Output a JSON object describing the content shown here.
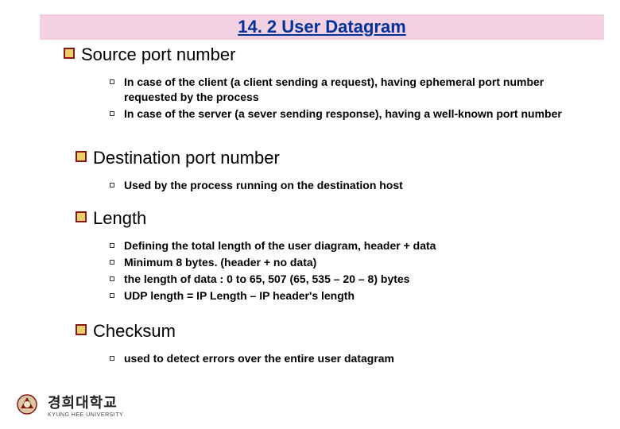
{
  "title": "14. 2 User Datagram",
  "sections": {
    "source": {
      "heading": "Source port number",
      "items": [
        "In case of the client (a client sending a request), having ephemeral port number requested by the process",
        "In case of the server (a sever sending response), having a well-known port number"
      ]
    },
    "dest": {
      "heading": "Destination port number",
      "items": [
        "Used by the process running on the destination host"
      ]
    },
    "length": {
      "heading": "Length",
      "items": [
        "Defining the total length of the user diagram, header + data",
        "Minimum 8 bytes. (header + no data)",
        "the length of data : 0 to 65, 507 (65, 535 – 20 – 8) bytes",
        "UDP length = IP Length – IP header's length"
      ]
    },
    "checksum": {
      "heading": "Checksum",
      "items": [
        "used to detect errors over the entire user datagram"
      ]
    }
  },
  "logo": {
    "korean": "경희대학교",
    "english": "KYUNG HEE UNIVERSITY"
  }
}
